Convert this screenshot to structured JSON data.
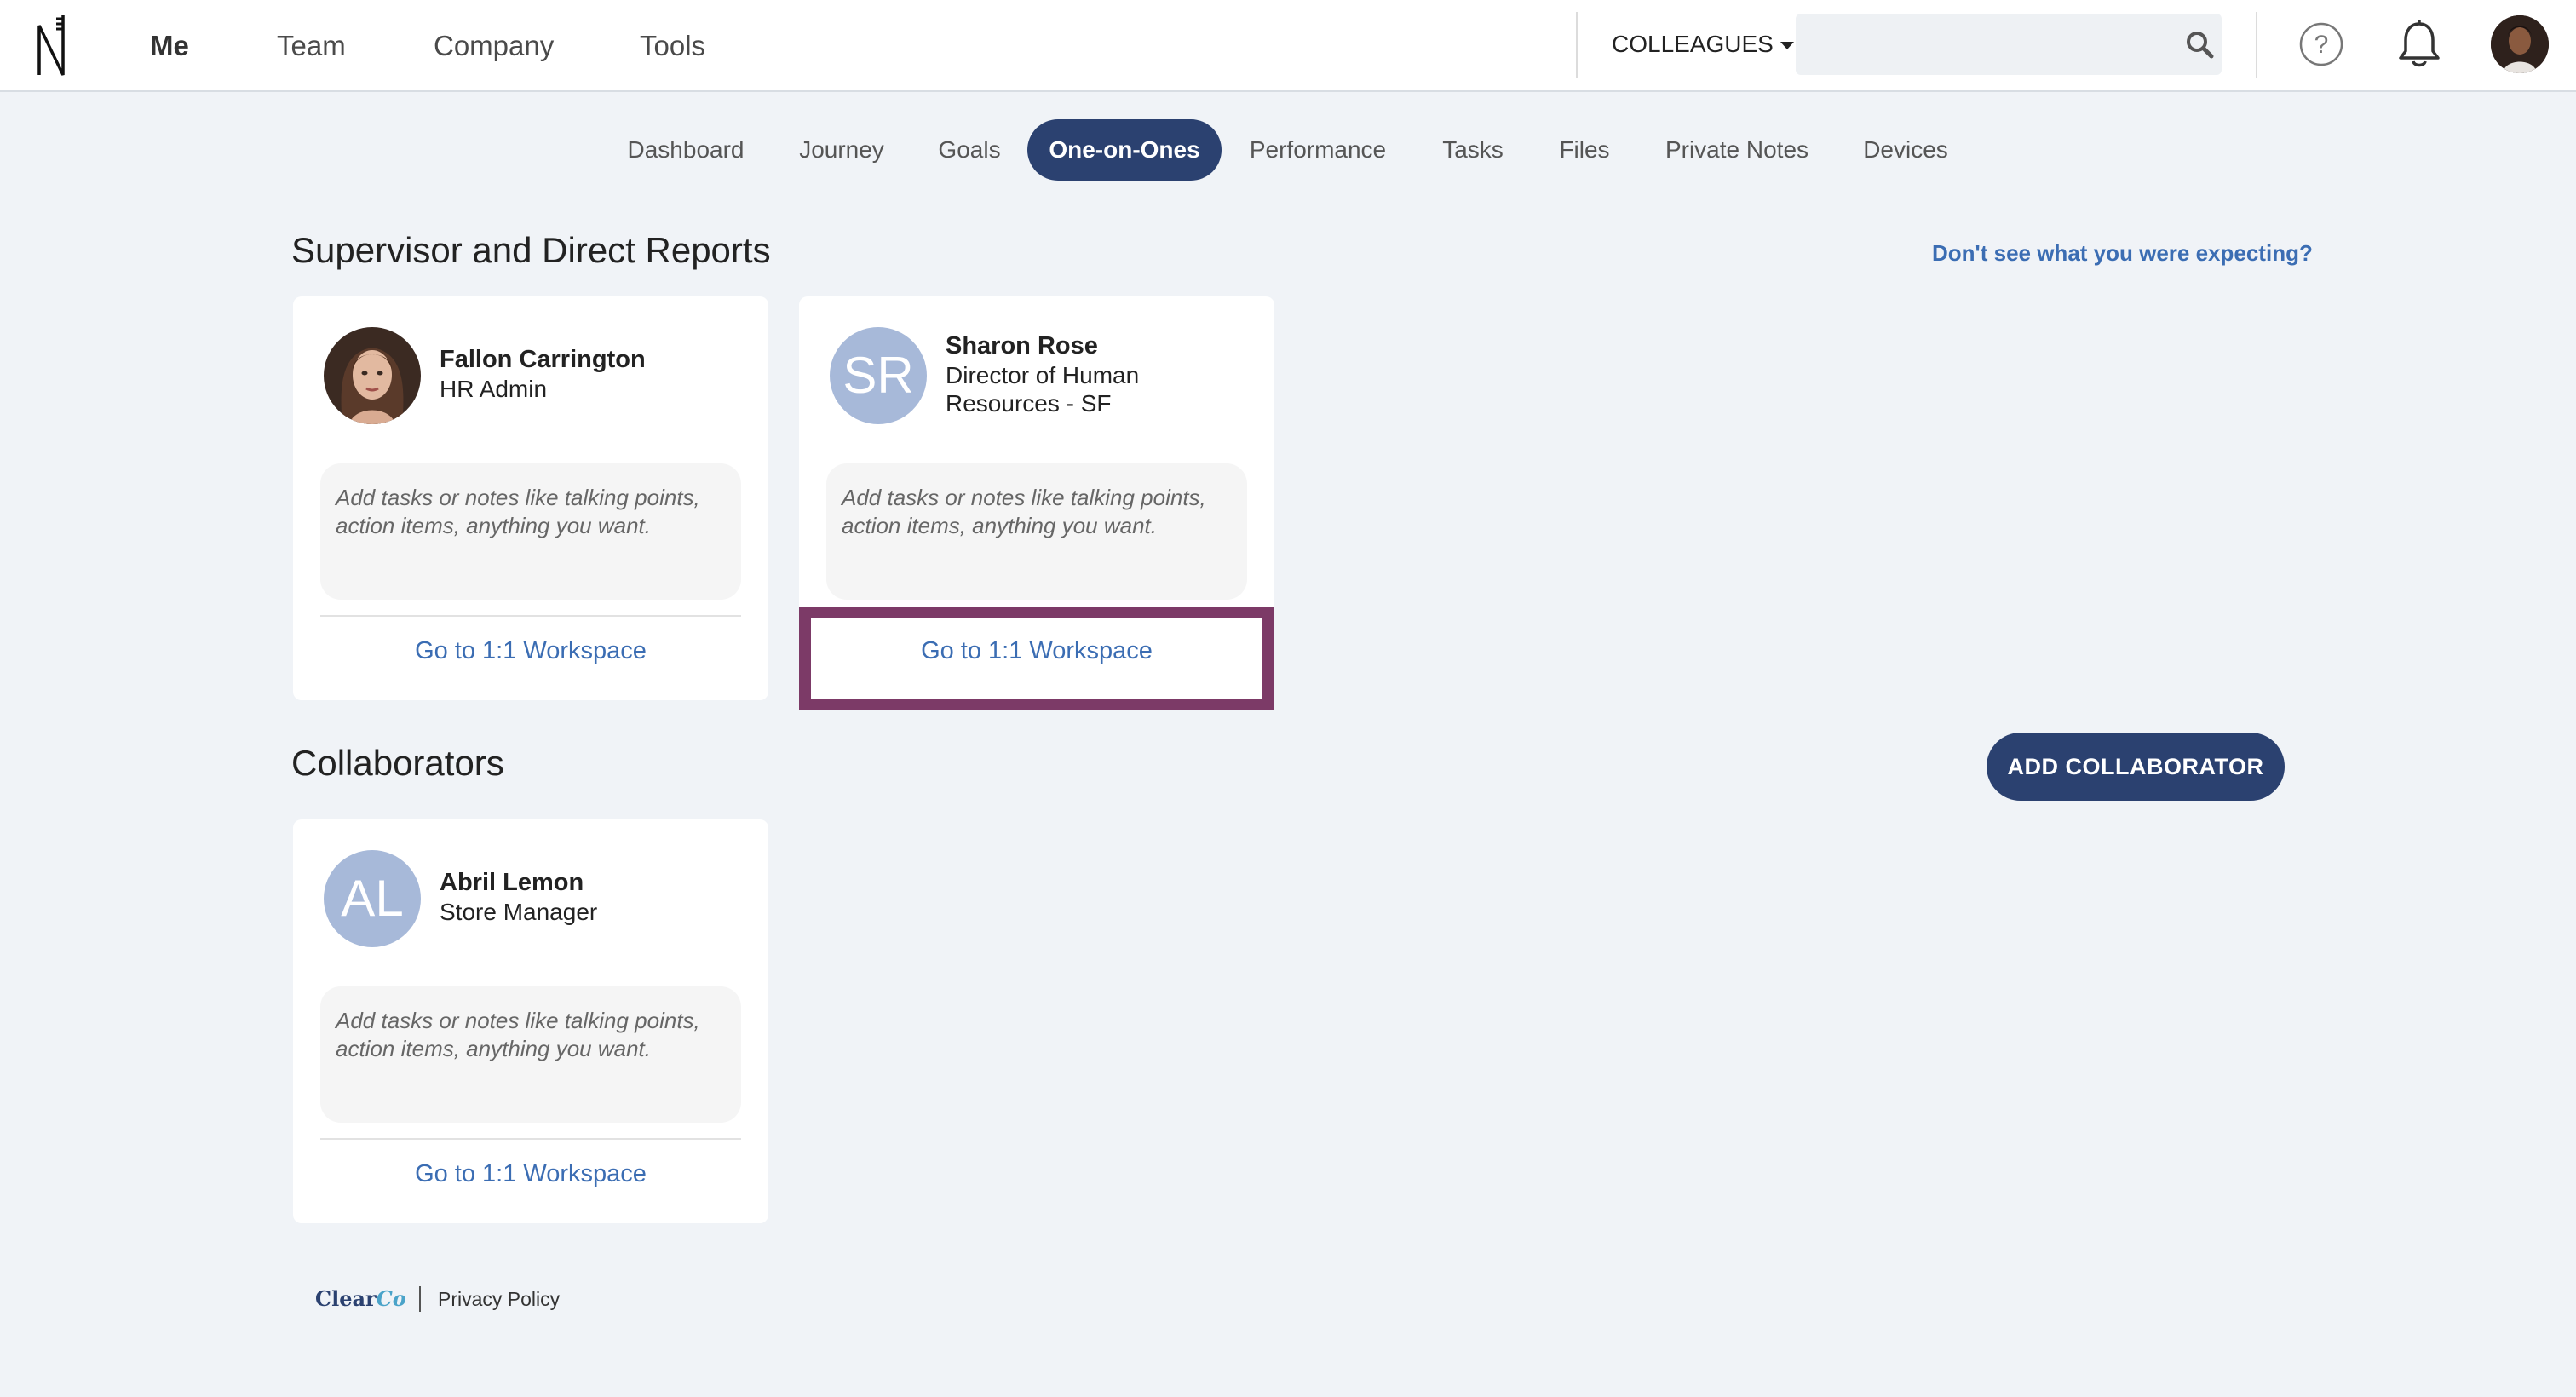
{
  "topbar": {
    "nav": [
      "Me",
      "Team",
      "Company",
      "Tools"
    ],
    "active_nav": "Me",
    "colleagues_label": "COLLEAGUES",
    "search_placeholder": "",
    "icons": [
      "logo-icon",
      "search-icon",
      "help-icon",
      "bell-icon",
      "avatar"
    ]
  },
  "subnav": {
    "items": [
      "Dashboard",
      "Journey",
      "Goals",
      "One-on-Ones",
      "Performance",
      "Tasks",
      "Files",
      "Private Notes",
      "Devices"
    ],
    "active": "One-on-Ones"
  },
  "supervisor_section": {
    "title": "Supervisor and Direct Reports",
    "help_link": "Don't see what you were expecting?",
    "cards": [
      {
        "name": "Fallon Carrington",
        "role": "HR Admin",
        "notes_placeholder": "Add tasks or notes like talking points, action items, anything you want.",
        "link": "Go to 1:1 Workspace"
      },
      {
        "initials": "SR",
        "name": "Sharon Rose",
        "role": "Director of Human Resources - SF",
        "notes_placeholder": "Add tasks or notes like talking points, action items, anything you want.",
        "link": "Go to 1:1 Workspace"
      }
    ]
  },
  "collaborators_section": {
    "title": "Collaborators",
    "add_button": "ADD COLLABORATOR",
    "cards": [
      {
        "initials": "AL",
        "name": "Abril Lemon",
        "role": "Store Manager",
        "notes_placeholder": "Add tasks or notes like talking points, action items, anything you want.",
        "link": "Go to 1:1 Workspace"
      }
    ]
  },
  "footer": {
    "logo_main": "Clear",
    "logo_accent": "Co",
    "privacy": "Privacy Policy"
  },
  "colors": {
    "primary": "#2b4170",
    "link": "#3b6db3",
    "highlight": "#7c3a67",
    "background": "#f0f3f7",
    "avatar_initials_bg": "#a7b9d9"
  }
}
